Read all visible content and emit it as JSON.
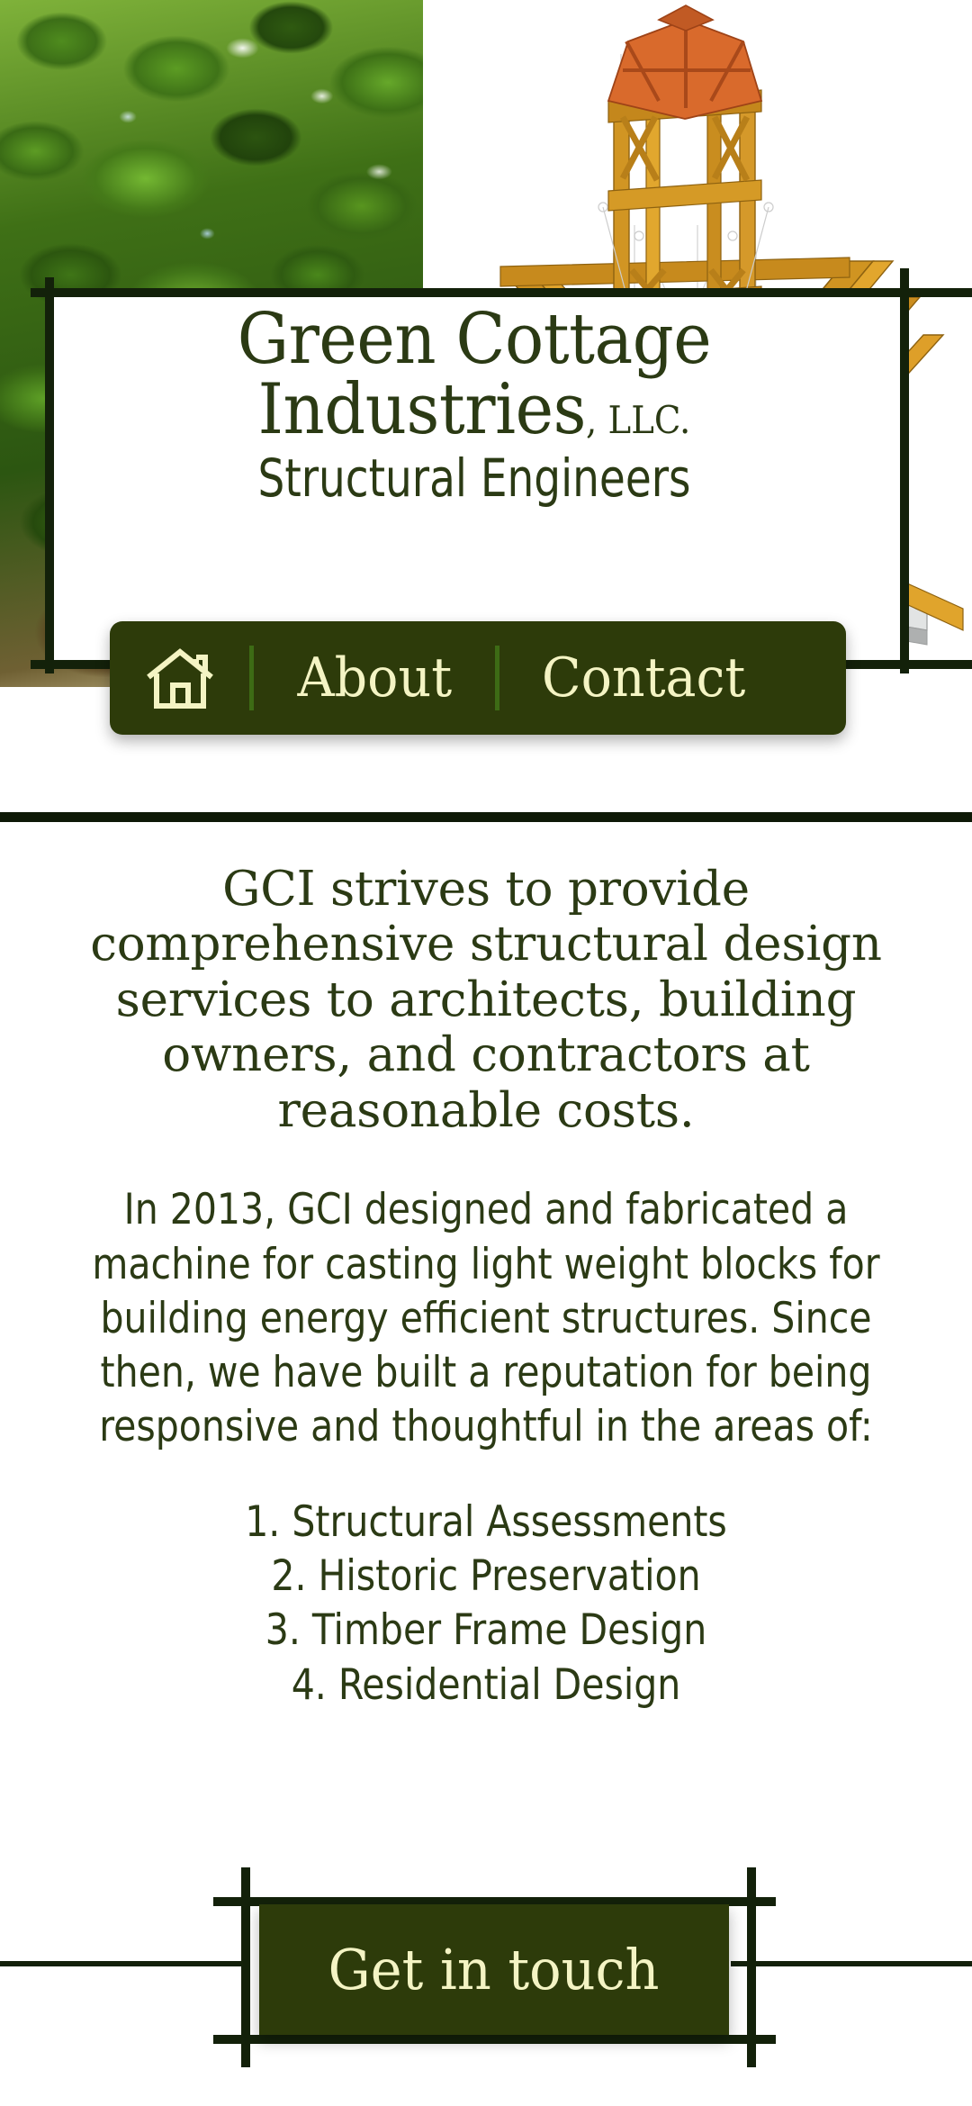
{
  "colors": {
    "brand_green": "#2b3a14",
    "nav_green": "#2d3b0a",
    "cream": "#f4f4c4",
    "frame_dark": "#13210a",
    "divider": "#0e1907",
    "nav_separator": "#3d6b15"
  },
  "hero": {
    "photo_alt": "timber frame structure under green tree canopy",
    "cad_alt": "CAD rendering of timber frame roof with octagonal cupola"
  },
  "brand": {
    "line1": "Green Cottage",
    "line2": "Industries",
    "line2_suffix": ", LLC.",
    "subtitle": "Structural Engineers"
  },
  "nav": {
    "home_icon": "home-icon",
    "items": [
      {
        "label": "About"
      },
      {
        "label": "Contact"
      }
    ]
  },
  "body": {
    "lede": "GCI strives to provide comprehensive structural design services to architects, building owners, and contractors at reasonable costs.",
    "paragraph": "In 2013, GCI designed and fabricated a machine for casting light weight blocks for building energy efficient structures. Since then, we have built a reputation for being responsive and thoughtful in the areas of:",
    "services": [
      "1. Structural Assessments",
      "2. Historic Preservation",
      "3. Timber Frame Design",
      "4. Residential Design"
    ]
  },
  "cta": {
    "label": "Get in touch"
  }
}
